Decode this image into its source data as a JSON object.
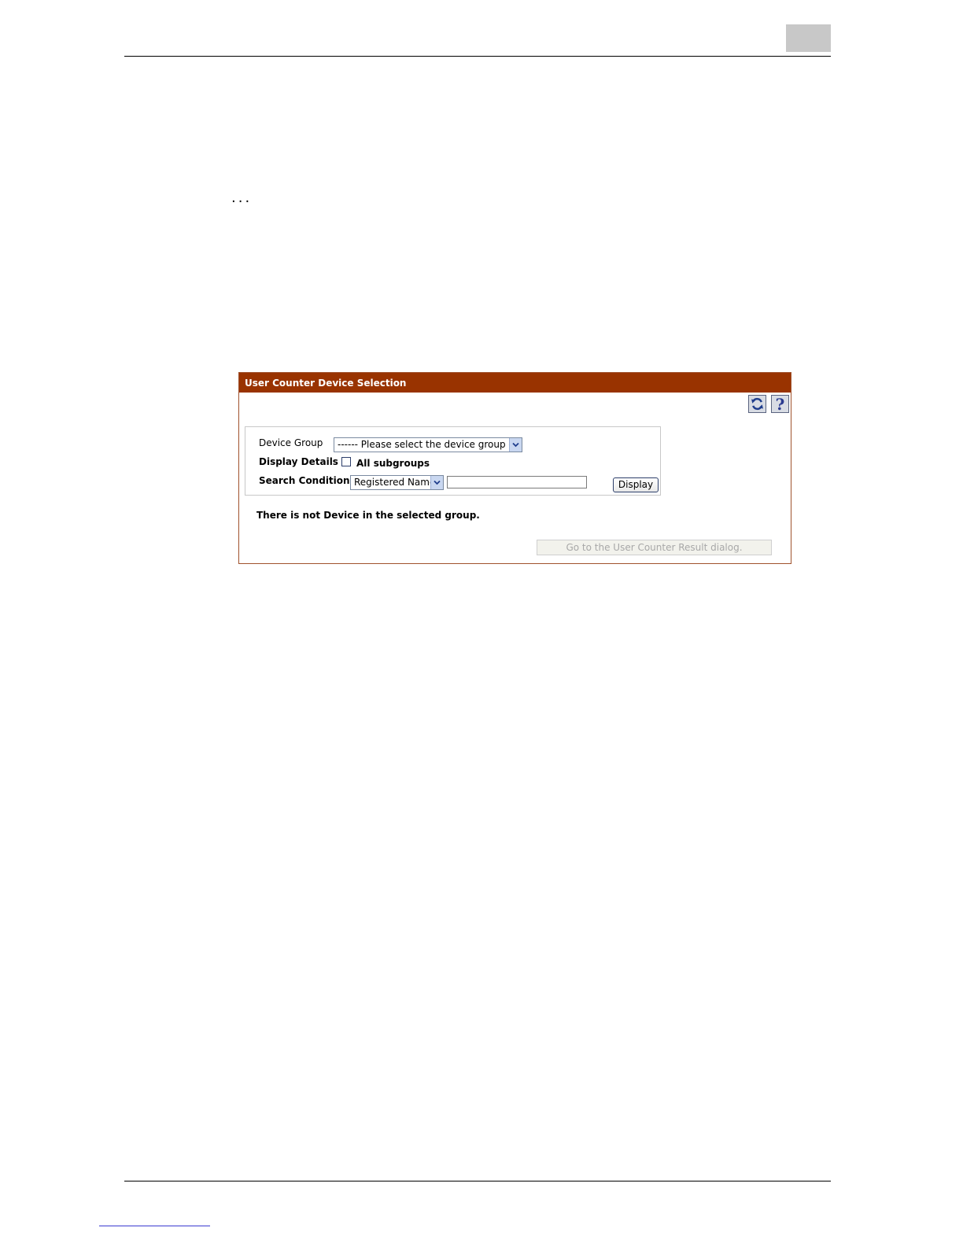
{
  "page": {
    "ellipsis": "..."
  },
  "dialog": {
    "title": "User Counter Device Selection",
    "toolbar": {
      "refresh_icon": "refresh-icon",
      "help_icon": "help-icon",
      "help_glyph": "?"
    },
    "form": {
      "device_group_label": "Device Group",
      "device_group_selected": "------ Please select the device group ------",
      "display_details_label": "Display Details",
      "all_subgroups_label": "All subgroups",
      "all_subgroups_checked": false,
      "search_condition_label": "Search Condition:",
      "search_condition_selected": "Registered Name",
      "search_text": "",
      "display_button": "Display"
    },
    "message": "There is not Device in the selected group.",
    "goto_button": "Go to the User Counter Result dialog."
  },
  "colors": {
    "title_bar": "#993300",
    "border": "#a0522d",
    "corner_tab": "#c8c8c8"
  }
}
